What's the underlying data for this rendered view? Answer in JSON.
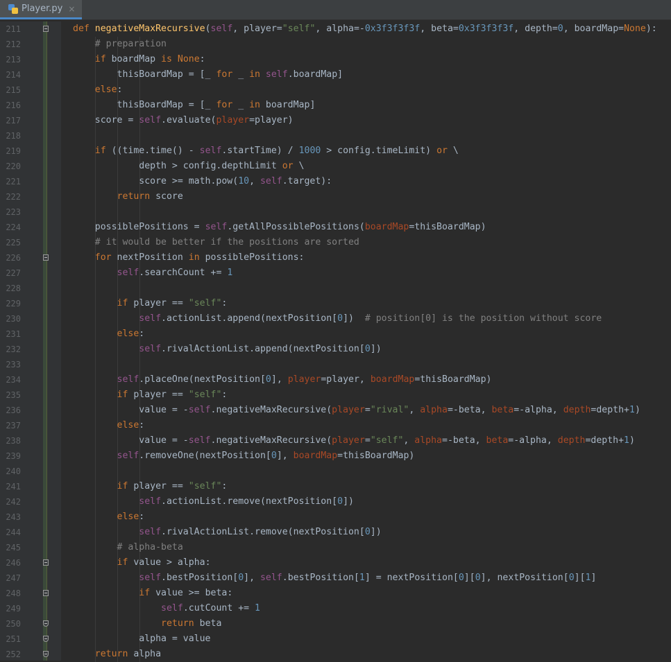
{
  "tab": {
    "filename": "Player.py",
    "icon": "python-file-icon",
    "close": "×"
  },
  "colors": {
    "background": "#2b2b2b",
    "keyword": "#cc7832",
    "function": "#ffc66d",
    "self": "#94558d",
    "string": "#6a8759",
    "number": "#6897bb",
    "comment": "#808080",
    "param": "#aa4926"
  },
  "lines": [
    {
      "n": "211",
      "fold": "start",
      "t": [
        [
          "kw",
          "def "
        ],
        [
          "fn",
          "negativeMaxRecursive"
        ],
        [
          "",
          "("
        ],
        [
          "sf",
          "self"
        ],
        [
          "",
          ", player="
        ],
        [
          "st",
          "\"self\""
        ],
        [
          "",
          ", alpha=-"
        ],
        [
          "nm",
          "0x3f3f3f3f"
        ],
        [
          "",
          ", beta="
        ],
        [
          "nm",
          "0x3f3f3f3f"
        ],
        [
          "",
          ", depth="
        ],
        [
          "nm",
          "0"
        ],
        [
          "",
          ", boardMap="
        ],
        [
          "kw",
          "None"
        ],
        [
          "",
          "):"
        ]
      ]
    },
    {
      "n": "212",
      "t": [
        [
          "",
          "    "
        ],
        [
          "cm",
          "# preparation"
        ]
      ]
    },
    {
      "n": "213",
      "t": [
        [
          "",
          "    "
        ],
        [
          "kw",
          "if "
        ],
        [
          "",
          "boardMap "
        ],
        [
          "kw",
          "is None"
        ],
        [
          "",
          ":"
        ]
      ]
    },
    {
      "n": "214",
      "t": [
        [
          "",
          "        thisBoardMap = [_ "
        ],
        [
          "kw",
          "for "
        ],
        [
          "",
          "_ "
        ],
        [
          "kw",
          "in "
        ],
        [
          "sf",
          "self"
        ],
        [
          "",
          ".boardMap]"
        ]
      ]
    },
    {
      "n": "215",
      "t": [
        [
          "",
          "    "
        ],
        [
          "kw",
          "else"
        ],
        [
          "",
          ":"
        ]
      ]
    },
    {
      "n": "216",
      "t": [
        [
          "",
          "        thisBoardMap = [_ "
        ],
        [
          "kw",
          "for "
        ],
        [
          "",
          "_ "
        ],
        [
          "kw",
          "in "
        ],
        [
          "",
          "boardMap]"
        ]
      ]
    },
    {
      "n": "217",
      "t": [
        [
          "",
          "    score = "
        ],
        [
          "sf",
          "self"
        ],
        [
          "",
          ".evaluate("
        ],
        [
          "pm",
          "player"
        ],
        [
          "",
          "=player)"
        ]
      ]
    },
    {
      "n": "218",
      "t": []
    },
    {
      "n": "219",
      "t": [
        [
          "",
          "    "
        ],
        [
          "kw",
          "if "
        ],
        [
          "",
          "((time.time() - "
        ],
        [
          "sf",
          "self"
        ],
        [
          "",
          ".startTime) / "
        ],
        [
          "nm",
          "1000"
        ],
        [
          "",
          " > config.timeLimit) "
        ],
        [
          "kw",
          "or "
        ],
        [
          "",
          "\\"
        ]
      ]
    },
    {
      "n": "220",
      "t": [
        [
          "",
          "            depth > config.depthLimit "
        ],
        [
          "kw",
          "or "
        ],
        [
          "",
          "\\"
        ]
      ]
    },
    {
      "n": "221",
      "t": [
        [
          "",
          "            score >= math.pow("
        ],
        [
          "nm",
          "10"
        ],
        [
          "",
          ", "
        ],
        [
          "sf",
          "self"
        ],
        [
          "",
          ".target):"
        ]
      ]
    },
    {
      "n": "222",
      "t": [
        [
          "",
          "        "
        ],
        [
          "kw",
          "return "
        ],
        [
          "",
          "score"
        ]
      ]
    },
    {
      "n": "223",
      "t": []
    },
    {
      "n": "224",
      "t": [
        [
          "",
          "    possiblePositions = "
        ],
        [
          "sf",
          "self"
        ],
        [
          "",
          ".getAllPossiblePositions("
        ],
        [
          "pm",
          "boardMap"
        ],
        [
          "",
          "=thisBoardMap)"
        ]
      ]
    },
    {
      "n": "225",
      "t": [
        [
          "",
          "    "
        ],
        [
          "cm",
          "# it would be better if the positions are sorted"
        ]
      ]
    },
    {
      "n": "226",
      "fold": "start",
      "t": [
        [
          "",
          "    "
        ],
        [
          "kw",
          "for "
        ],
        [
          "",
          "nextPosition "
        ],
        [
          "kw",
          "in "
        ],
        [
          "",
          "possiblePositions:"
        ]
      ]
    },
    {
      "n": "227",
      "t": [
        [
          "",
          "        "
        ],
        [
          "sf",
          "self"
        ],
        [
          "",
          ".searchCount += "
        ],
        [
          "nm",
          "1"
        ]
      ]
    },
    {
      "n": "228",
      "t": []
    },
    {
      "n": "229",
      "t": [
        [
          "",
          "        "
        ],
        [
          "kw",
          "if "
        ],
        [
          "",
          "player == "
        ],
        [
          "st",
          "\"self\""
        ],
        [
          "",
          ":"
        ]
      ]
    },
    {
      "n": "230",
      "t": [
        [
          "",
          "            "
        ],
        [
          "sf",
          "self"
        ],
        [
          "",
          ".actionList.append(nextPosition["
        ],
        [
          "nm",
          "0"
        ],
        [
          "",
          "])  "
        ],
        [
          "cm",
          "# position[0] is the position without score"
        ]
      ]
    },
    {
      "n": "231",
      "t": [
        [
          "",
          "        "
        ],
        [
          "kw",
          "else"
        ],
        [
          "",
          ":"
        ]
      ]
    },
    {
      "n": "232",
      "t": [
        [
          "",
          "            "
        ],
        [
          "sf",
          "self"
        ],
        [
          "",
          ".rivalActionList.append(nextPosition["
        ],
        [
          "nm",
          "0"
        ],
        [
          "",
          "])"
        ]
      ]
    },
    {
      "n": "233",
      "t": []
    },
    {
      "n": "234",
      "t": [
        [
          "",
          "        "
        ],
        [
          "sf",
          "self"
        ],
        [
          "",
          ".placeOne(nextPosition["
        ],
        [
          "nm",
          "0"
        ],
        [
          "",
          "], "
        ],
        [
          "pm",
          "player"
        ],
        [
          "",
          "=player, "
        ],
        [
          "pm",
          "boardMap"
        ],
        [
          "",
          "=thisBoardMap)"
        ]
      ]
    },
    {
      "n": "235",
      "t": [
        [
          "",
          "        "
        ],
        [
          "kw",
          "if "
        ],
        [
          "",
          "player == "
        ],
        [
          "st",
          "\"self\""
        ],
        [
          "",
          ":"
        ]
      ]
    },
    {
      "n": "236",
      "t": [
        [
          "",
          "            value = -"
        ],
        [
          "sf",
          "self"
        ],
        [
          "",
          ".negativeMaxRecursive("
        ],
        [
          "pm",
          "player"
        ],
        [
          "",
          "="
        ],
        [
          "st",
          "\"rival\""
        ],
        [
          "",
          ", "
        ],
        [
          "pm",
          "alpha"
        ],
        [
          "",
          "=-beta, "
        ],
        [
          "pm",
          "beta"
        ],
        [
          "",
          "=-alpha, "
        ],
        [
          "pm",
          "depth"
        ],
        [
          "",
          "=depth+"
        ],
        [
          "nm",
          "1"
        ],
        [
          "",
          ")"
        ]
      ]
    },
    {
      "n": "237",
      "t": [
        [
          "",
          "        "
        ],
        [
          "kw",
          "else"
        ],
        [
          "",
          ":"
        ]
      ]
    },
    {
      "n": "238",
      "t": [
        [
          "",
          "            value = -"
        ],
        [
          "sf",
          "self"
        ],
        [
          "",
          ".negativeMaxRecursive("
        ],
        [
          "pm",
          "player"
        ],
        [
          "",
          "="
        ],
        [
          "st",
          "\"self\""
        ],
        [
          "",
          ", "
        ],
        [
          "pm",
          "alpha"
        ],
        [
          "",
          "=-beta, "
        ],
        [
          "pm",
          "beta"
        ],
        [
          "",
          "=-alpha, "
        ],
        [
          "pm",
          "depth"
        ],
        [
          "",
          "=depth+"
        ],
        [
          "nm",
          "1"
        ],
        [
          "",
          ")"
        ]
      ]
    },
    {
      "n": "239",
      "t": [
        [
          "",
          "        "
        ],
        [
          "sf",
          "self"
        ],
        [
          "",
          ".removeOne(nextPosition["
        ],
        [
          "nm",
          "0"
        ],
        [
          "",
          "], "
        ],
        [
          "pm",
          "boardMap"
        ],
        [
          "",
          "=thisBoardMap)"
        ]
      ]
    },
    {
      "n": "240",
      "t": []
    },
    {
      "n": "241",
      "t": [
        [
          "",
          "        "
        ],
        [
          "kw",
          "if "
        ],
        [
          "",
          "player == "
        ],
        [
          "st",
          "\"self\""
        ],
        [
          "",
          ":"
        ]
      ]
    },
    {
      "n": "242",
      "t": [
        [
          "",
          "            "
        ],
        [
          "sf",
          "self"
        ],
        [
          "",
          ".actionList.remove(nextPosition["
        ],
        [
          "nm",
          "0"
        ],
        [
          "",
          "])"
        ]
      ]
    },
    {
      "n": "243",
      "t": [
        [
          "",
          "        "
        ],
        [
          "kw",
          "else"
        ],
        [
          "",
          ":"
        ]
      ]
    },
    {
      "n": "244",
      "t": [
        [
          "",
          "            "
        ],
        [
          "sf",
          "self"
        ],
        [
          "",
          ".rivalActionList.remove(nextPosition["
        ],
        [
          "nm",
          "0"
        ],
        [
          "",
          "])"
        ]
      ]
    },
    {
      "n": "245",
      "t": [
        [
          "",
          "        "
        ],
        [
          "cm",
          "# alpha-beta"
        ]
      ]
    },
    {
      "n": "246",
      "fold": "start",
      "t": [
        [
          "",
          "        "
        ],
        [
          "kw",
          "if "
        ],
        [
          "",
          "value > alpha:"
        ]
      ]
    },
    {
      "n": "247",
      "t": [
        [
          "",
          "            "
        ],
        [
          "sf",
          "self"
        ],
        [
          "",
          ".bestPosition["
        ],
        [
          "nm",
          "0"
        ],
        [
          "",
          "], "
        ],
        [
          "sf",
          "self"
        ],
        [
          "",
          ".bestPosition["
        ],
        [
          "nm",
          "1"
        ],
        [
          "",
          "] = nextPosition["
        ],
        [
          "nm",
          "0"
        ],
        [
          "",
          "]["
        ],
        [
          "nm",
          "0"
        ],
        [
          "",
          "], nextPosition["
        ],
        [
          "nm",
          "0"
        ],
        [
          "",
          "]["
        ],
        [
          "nm",
          "1"
        ],
        [
          "",
          "]"
        ]
      ]
    },
    {
      "n": "248",
      "fold": "start",
      "t": [
        [
          "",
          "            "
        ],
        [
          "kw",
          "if "
        ],
        [
          "",
          "value >= beta:"
        ]
      ]
    },
    {
      "n": "249",
      "t": [
        [
          "",
          "                "
        ],
        [
          "sf",
          "self"
        ],
        [
          "",
          ".cutCount += "
        ],
        [
          "nm",
          "1"
        ]
      ]
    },
    {
      "n": "250",
      "fold": "end",
      "t": [
        [
          "",
          "                "
        ],
        [
          "kw",
          "return "
        ],
        [
          "",
          "beta"
        ]
      ]
    },
    {
      "n": "251",
      "fold": "end",
      "t": [
        [
          "",
          "            alpha = value"
        ]
      ]
    },
    {
      "n": "252",
      "fold": "end",
      "t": [
        [
          "",
          "    "
        ],
        [
          "kw",
          "return "
        ],
        [
          "",
          "alpha"
        ]
      ]
    }
  ]
}
